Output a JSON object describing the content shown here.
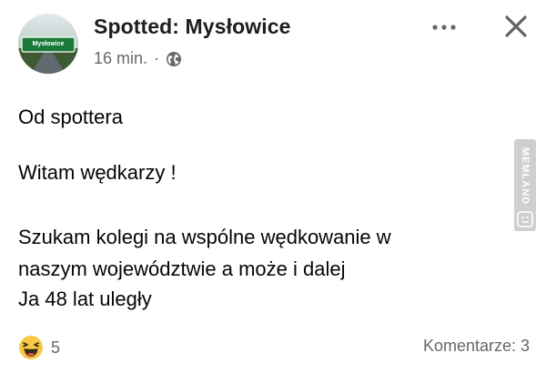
{
  "post": {
    "page_name": "Spotted: Mysłowice",
    "avatar_sign_text": "Mysłowice",
    "timestamp": "16 min.",
    "separator": "·",
    "privacy_icon": "globe-icon",
    "lines": [
      "Od spottera",
      "Witam wędkarzy !",
      "Szukam kolegi na wspólne wędkowanie w",
      "naszym województwie a może i dalej",
      "Ja 48 lat uległy"
    ],
    "reaction_icon": "haha-emoji-icon",
    "reaction_count": "5",
    "comments_label": "Komentarze: 3"
  },
  "header_actions": {
    "more_icon": "more-horizontal-icon",
    "close_icon": "close-icon"
  },
  "watermark": {
    "text": "MEMLAND"
  },
  "colors": {
    "text": "#050505",
    "secondary_text": "#65676b",
    "haha_yellow": "#f7c846",
    "watermark_grey": "#cfcfcf"
  }
}
